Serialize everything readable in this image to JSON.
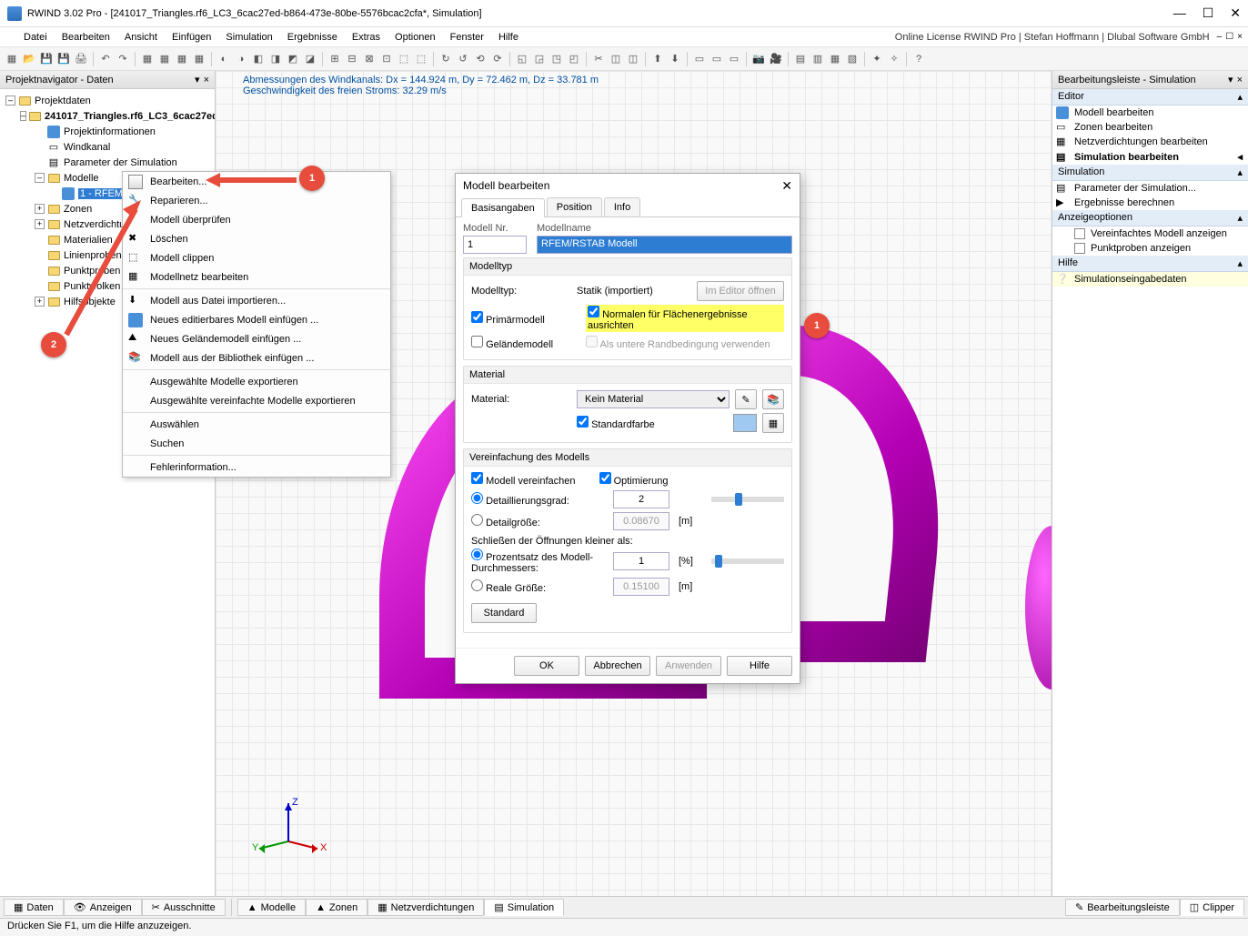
{
  "titlebar": {
    "title": "RWIND 3.02 Pro - [241017_Triangles.rf6_LC3_6cac27ed-b864-473e-80be-5576bcac2cfa*, Simulation]"
  },
  "menubar": {
    "items": [
      "Datei",
      "Bearbeiten",
      "Ansicht",
      "Einfügen",
      "Simulation",
      "Ergebnisse",
      "Extras",
      "Optionen",
      "Fenster",
      "Hilfe"
    ],
    "license": "Online License RWIND Pro | Stefan Hoffmann | Dlubal Software GmbH"
  },
  "navigator": {
    "title": "Projektnavigator - Daten",
    "root": "Projektdaten",
    "project": "241017_Triangles.rf6_LC3_6cac27ed",
    "nodes": [
      "Projektinformationen",
      "Windkanal",
      "Parameter der Simulation"
    ],
    "modelle_label": "Modelle",
    "selected": "1 - RFEM/RSTAB ...",
    "after_model": [
      "Zonen",
      "Netzverdichtung",
      "Materialien",
      "Linienproben",
      "Punktproben",
      "Punktwolken",
      "Hilfsobjekte"
    ]
  },
  "viewport": {
    "line1": "Abmessungen des Windkanals: Dx = 144.924 m, Dy = 72.462 m, Dz = 33.781 m",
    "line2": "Geschwindigkeit des freien Stroms: 32.29 m/s"
  },
  "ctxmenu": {
    "items": [
      "Bearbeiten...",
      "Reparieren...",
      "Modell überprüfen",
      "Löschen",
      "Modell clippen",
      "Modellnetz bearbeiten",
      "Modell aus Datei importieren...",
      "Neues editierbares Modell einfügen ...",
      "Neues Geländemodell einfügen ...",
      "Modell aus der Bibliothek einfügen ...",
      "Ausgewählte Modelle exportieren",
      "Ausgewählte vereinfachte Modelle exportieren",
      "Auswählen",
      "Suchen",
      "Fehlerinformation..."
    ]
  },
  "dialog": {
    "title": "Modell bearbeiten",
    "tabs": [
      "Basisangaben",
      "Position",
      "Info"
    ],
    "modelnr_label": "Modell Nr.",
    "modelnr_value": "1",
    "modelname_label": "Modellname",
    "modelname_value": "RFEM/RSTAB Modell",
    "modeltype_group": "Modelltyp",
    "modeltype_label": "Modelltyp:",
    "statik": "Statik (importiert)",
    "imeditor": "Im Editor öffnen",
    "primar": "Primärmodell",
    "gelaende": "Geländemodell",
    "normalen": "Normalen für Flächenergebnisse ausrichten",
    "untere": "Als untere Randbedingung verwenden",
    "material_group": "Material",
    "material_label": "Material:",
    "material_value": "Kein Material",
    "stdcolor": "Standardfarbe",
    "simpl_group": "Vereinfachung des Modells",
    "modsimpl": "Modell vereinfachen",
    "optim": "Optimierung",
    "detailgrad": "Detaillierungsgrad:",
    "detailgrad_val": "2",
    "detailgr": "Detailgröße:",
    "detailgr_val": "0.08670",
    "unit_m": "[m]",
    "schliessen": "Schließen der Öffnungen kleiner als:",
    "prozent": "Prozentsatz des Modell-Durchmessers:",
    "prozent_val": "1",
    "unit_pct": "[%]",
    "reale": "Reale Größe:",
    "reale_val": "0.15100",
    "standard_btn": "Standard",
    "ok": "OK",
    "cancel": "Abbrechen",
    "apply": "Anwenden",
    "help": "Hilfe"
  },
  "right": {
    "title": "Bearbeitungsleiste - Simulation",
    "editor_label": "Editor",
    "editor_items": [
      "Modell bearbeiten",
      "Zonen bearbeiten",
      "Netzverdichtungen bearbeiten",
      "Simulation bearbeiten"
    ],
    "sim_label": "Simulation",
    "sim_items": [
      "Parameter der Simulation...",
      "Ergebnisse berechnen"
    ],
    "disp_label": "Anzeigeoptionen",
    "disp_items": [
      "Vereinfachtes Modell anzeigen",
      "Punktproben anzeigen"
    ],
    "help_label": "Hilfe",
    "help_item": "Simulationseingabedaten"
  },
  "bottomtabs": {
    "left": [
      "Daten",
      "Anzeigen",
      "Ausschnitte"
    ],
    "mid": [
      "Modelle",
      "Zonen",
      "Netzverdichtungen",
      "Simulation"
    ],
    "right": [
      "Bearbeitungsleiste",
      "Clipper"
    ]
  },
  "statusbar": {
    "text": "Drücken Sie F1, um die Hilfe anzuzeigen."
  },
  "callouts": {
    "one": "1",
    "two": "2"
  }
}
